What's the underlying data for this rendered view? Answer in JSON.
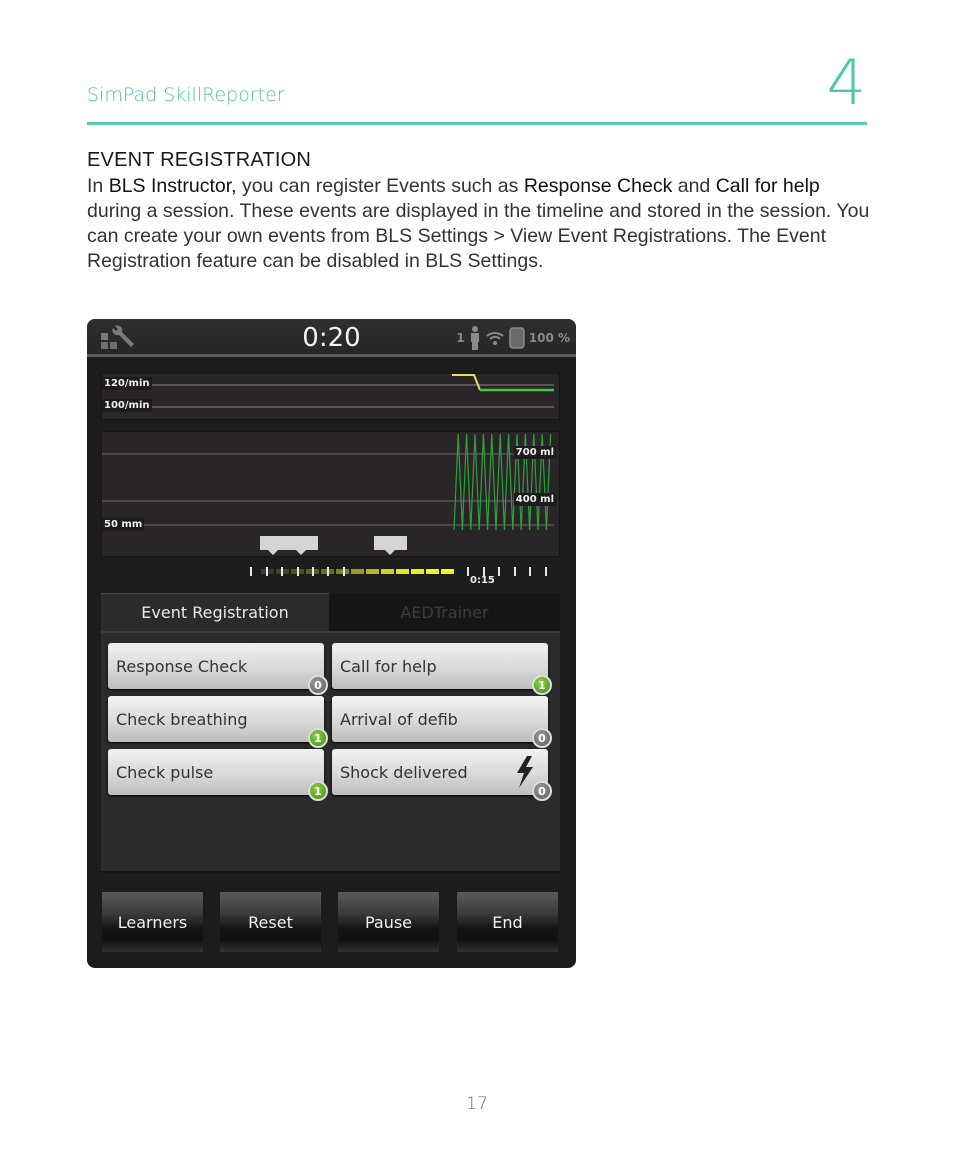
{
  "page": {
    "running_head": "SimPad SkillReporter",
    "chapter_number": "4",
    "section_title": "EVENT REGISTRATION",
    "paragraph": {
      "t1": "In ",
      "b1": "BLS Instructor,",
      "t2": " you can register Events such as ",
      "b2": "Response Check",
      "t3": " and ",
      "b3": "Call for help",
      "t4": " during a session. These events are displayed in the timeline and stored in the session. You can create your own events from BLS Settings > View Event Registrations. The Event Registration feature can be disabled in BLS Settings."
    },
    "page_number": "17",
    "accent_color": "#4fc4b3"
  },
  "device": {
    "topbar": {
      "tools_icon": "tools-icon",
      "elapsed_time": "0:20",
      "learner_count": "1",
      "battery_level": "100 %"
    },
    "rate_chart": {
      "labels": [
        "120/min",
        "100/min"
      ],
      "series_colors": {
        "yellow": "#e8e25a",
        "green": "#3ecb3e"
      }
    },
    "cpr_chart": {
      "labels": {
        "high_volume": "700 ml",
        "low_volume": "400 ml",
        "depth": "50 mm"
      }
    },
    "timeline": {
      "time_label": "0:15",
      "event_markers": 3
    },
    "tabs": [
      {
        "label": "Event Registration",
        "active": true
      },
      {
        "label": "AEDTrainer",
        "active": false
      }
    ],
    "events": [
      {
        "label": "Response Check",
        "count": "0"
      },
      {
        "label": "Call for help",
        "count": "1"
      },
      {
        "label": "Check breathing",
        "count": "1"
      },
      {
        "label": "Arrival of defib",
        "count": "0"
      },
      {
        "label": "Check pulse",
        "count": "1"
      },
      {
        "label": "Shock delivered",
        "count": "0",
        "icon": "lightning-bolt-icon"
      }
    ],
    "controls": [
      {
        "label": "Learners"
      },
      {
        "label": "Reset"
      },
      {
        "label": "Pause"
      },
      {
        "label": "End"
      }
    ]
  }
}
